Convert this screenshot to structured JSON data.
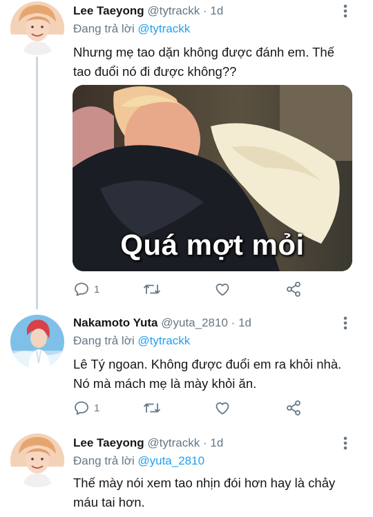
{
  "colors": {
    "link": "#1da1f2",
    "secondary": "#657786",
    "text": "#14171a",
    "divider": "#e6ecf0"
  },
  "tweets": [
    {
      "name": "Lee Taeyong",
      "handle": "@tytrackk",
      "dot": "·",
      "time": "1d",
      "reply_prefix": "Đang trả lời",
      "reply_to": "@tytrackk",
      "text_lines": [
        "Nhưng mẹ tao dặn không được đánh em. Thế",
        "tao đuổi nó đi được không??"
      ],
      "media_caption": "Quá mợt mỏi",
      "reply_count": "1",
      "retweet_count": "",
      "like_count": ""
    },
    {
      "name": "Nakamoto Yuta",
      "handle": "@yuta_2810",
      "dot": "·",
      "time": "1d",
      "reply_prefix": "Đang trả lời",
      "reply_to": "@tytrackk",
      "text_lines": [
        "Lê Tý ngoan. Không được đuổi em ra khỏi nhà.",
        "Nó mà mách mẹ  là mày  khỏi ăn."
      ],
      "reply_count": "1",
      "retweet_count": "",
      "like_count": ""
    },
    {
      "name": "Lee Taeyong",
      "handle": "@tytrackk",
      "dot": "·",
      "time": "1d",
      "reply_prefix": "Đang trả lời",
      "reply_to": "@yuta_2810",
      "text_lines": [
        "Thế mày nói xem tao nhịn đói hơn hay là chảy",
        "máu tai hơn."
      ]
    }
  ]
}
